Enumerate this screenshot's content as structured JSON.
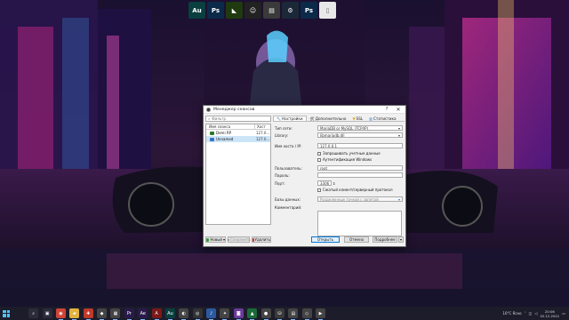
{
  "desktop": {
    "top_dock": [
      {
        "icon": "adobe-audition-icon",
        "label": "Au",
        "color": "#0a3f3f"
      },
      {
        "icon": "photoshop-icon",
        "label": "Ps",
        "color": "#0b2a4a"
      },
      {
        "icon": "nvidia-icon",
        "label": "◣",
        "color": "#1f3a0f"
      },
      {
        "icon": "steam-ghost-icon",
        "label": "☺",
        "color": "#222222"
      },
      {
        "icon": "notes-icon",
        "label": "▤",
        "color": "#3a3a3a"
      },
      {
        "icon": "steam-icon",
        "label": "⚙",
        "color": "#1b2838"
      },
      {
        "icon": "photoshop-icon-2",
        "label": "Ps",
        "color": "#0b2a4a"
      },
      {
        "icon": "document-icon",
        "label": "▯",
        "color": "#e8e8e8"
      }
    ]
  },
  "dialog": {
    "title": "Менеджер сеансов",
    "help_label": "?",
    "close_label": "✕",
    "filter_placeholder": "Фильтр",
    "tree": {
      "col_name": "Имя сеанса",
      "col_host": "Хост",
      "rows": [
        {
          "name": "Demi RP",
          "host": "127.0..."
        },
        {
          "name": "Unnamed",
          "host": "127.0..."
        }
      ]
    },
    "tabs": [
      "Настройки",
      "Дополнительно",
      "SSL",
      "Статистика"
    ],
    "form": {
      "network_type_label": "Тип сети:",
      "network_type_value": "MariaDB or MySQL (TCP/IP)",
      "library_label": "Library:",
      "library_value": "libmariadb.dll",
      "host_label": "Имя хоста / IP:",
      "host_value": "127.0.0.1",
      "remember_credentials": "Запрашивать учетные данные",
      "windows_auth": "Аутентификация Windows",
      "user_label": "Пользователь:",
      "user_value": "root",
      "password_label": "Пароль:",
      "password_value": "",
      "port_label": "Порт:",
      "port_value": "3306",
      "compressed": "Сжатый клиент/серверный протокол",
      "databases_label": "Базы данных:",
      "databases_placeholder": "Разделенные точкой с запятой",
      "comment_label": "Комментарий:"
    },
    "buttons": {
      "new": "Новый",
      "save": "Сохранить",
      "delete": "Удалить",
      "open": "Открыть",
      "cancel": "Отмена",
      "more": "Подробнее"
    }
  },
  "taskbar": {
    "apps": [
      {
        "icon": "windows-search-icon",
        "glyph": "⌕",
        "color": "#2b2b3a"
      },
      {
        "icon": "task-view-icon",
        "glyph": "▣",
        "color": "#2b2b3a"
      },
      {
        "icon": "chrome-icon",
        "glyph": "◉",
        "color": "#d04437"
      },
      {
        "icon": "explorer-icon",
        "glyph": "▰",
        "color": "#e3b341"
      },
      {
        "icon": "tool-icon",
        "glyph": "✚",
        "color": "#c0392b"
      },
      {
        "icon": "taskbar-app-6-icon",
        "glyph": "◆",
        "color": "#444"
      },
      {
        "icon": "taskbar-app-7-icon",
        "glyph": "▦",
        "color": "#444"
      },
      {
        "icon": "premiere-icon",
        "glyph": "Pr",
        "color": "#2a1a4a"
      },
      {
        "icon": "after-effects-icon",
        "glyph": "Ae",
        "color": "#2a1a4a"
      },
      {
        "icon": "adobe-icon",
        "glyph": "A",
        "color": "#7a1a1a"
      },
      {
        "icon": "audition-icon",
        "glyph": "Au",
        "color": "#0a3f3f"
      },
      {
        "icon": "taskbar-app-12-icon",
        "glyph": "◐",
        "color": "#444"
      },
      {
        "icon": "obs-icon",
        "glyph": "◎",
        "color": "#333"
      },
      {
        "icon": "taskbar-app-14-icon",
        "glyph": "♪",
        "color": "#2c5aa0"
      },
      {
        "icon": "taskbar-app-15-icon",
        "glyph": "✦",
        "color": "#444"
      },
      {
        "icon": "taskbar-app-16-icon",
        "glyph": "◙",
        "color": "#6a3a9a"
      },
      {
        "icon": "taskbar-app-17-icon",
        "glyph": "▲",
        "color": "#1a6a3a"
      },
      {
        "icon": "taskbar-app-18-icon",
        "glyph": "●",
        "color": "#444"
      },
      {
        "icon": "heidisql-icon",
        "glyph": "⛁",
        "color": "#3a3a3a"
      },
      {
        "icon": "taskbar-app-20-icon",
        "glyph": "▤",
        "color": "#444"
      },
      {
        "icon": "taskbar-app-21-icon",
        "glyph": "◇",
        "color": "#444"
      },
      {
        "icon": "taskbar-app-22-icon",
        "glyph": "▶",
        "color": "#444"
      }
    ],
    "weather": "10°C Ясно",
    "time": "20:06",
    "date": "02.12.2021"
  },
  "colors": {
    "accent": "#0078d7",
    "selection": "#cce4f7"
  }
}
